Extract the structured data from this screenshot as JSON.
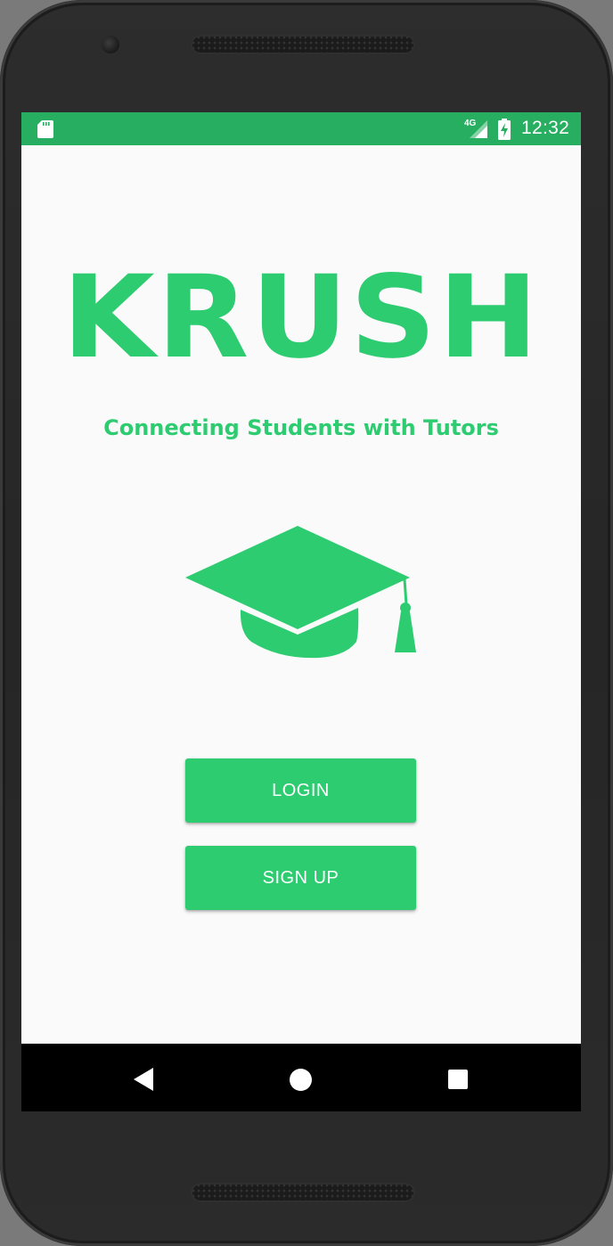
{
  "status_bar": {
    "network_label": "4G",
    "time": "12:32",
    "icons": [
      "sd-card-icon",
      "cellular-signal-icon",
      "battery-charging-icon"
    ],
    "background_color": "#27ae60"
  },
  "main": {
    "title": "KRUSH",
    "tagline": "Connecting Students with Tutors",
    "hero_icon": "graduation-cap-icon",
    "accent_color": "#2ecc71"
  },
  "buttons": {
    "login_label": "LOGIN",
    "signup_label": "SIGN UP"
  },
  "nav_bar": {
    "icons": [
      "back-icon",
      "home-icon",
      "recents-icon"
    ]
  }
}
